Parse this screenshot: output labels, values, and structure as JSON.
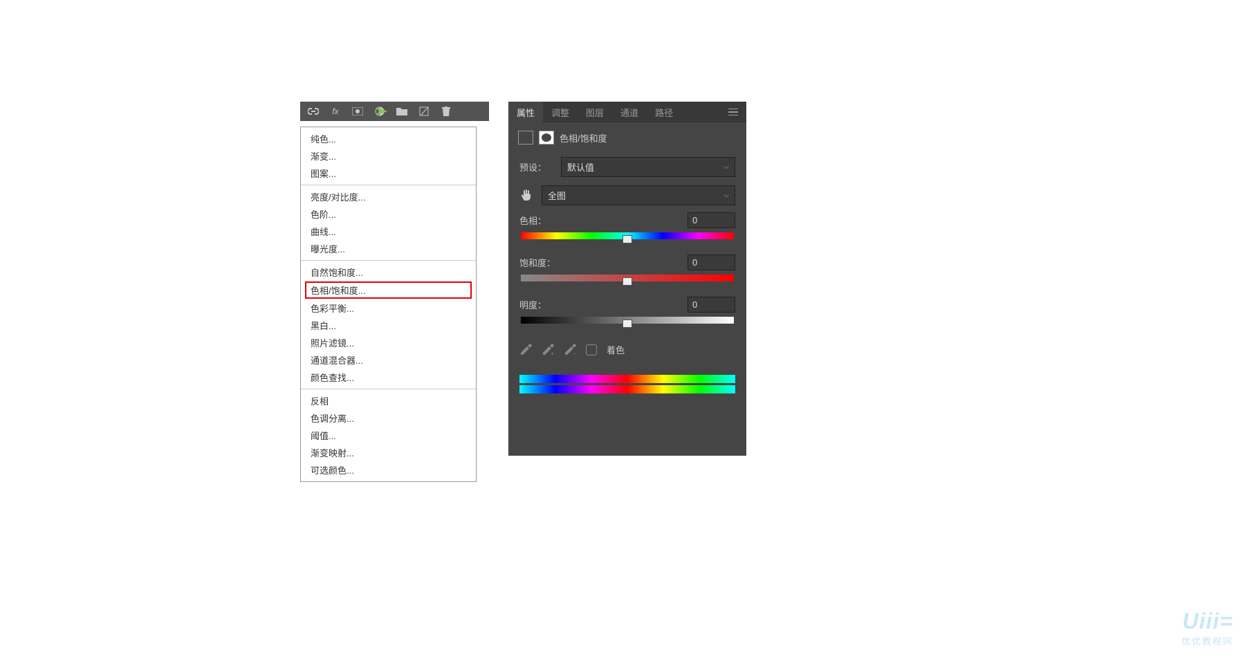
{
  "menu": {
    "g1": [
      "纯色...",
      "渐变...",
      "图案..."
    ],
    "g2": [
      "亮度/对比度...",
      "色阶...",
      "曲线...",
      "曝光度..."
    ],
    "g3": [
      "自然饱和度...",
      "色相/饱和度...",
      "色彩平衡...",
      "黑白...",
      "照片滤镜...",
      "通道混合器...",
      "颜色查找..."
    ],
    "g4": [
      "反相",
      "色调分离...",
      "阈值...",
      "渐变映射...",
      "可选颜色..."
    ]
  },
  "tabs": [
    "属性",
    "调整",
    "图层",
    "通道",
    "路径"
  ],
  "header": "色相/饱和度",
  "preset": {
    "label": "预设：",
    "value": "默认值"
  },
  "scope": "全图",
  "sliders": {
    "hue": {
      "label": "色相：",
      "value": "0"
    },
    "sat": {
      "label": "饱和度：",
      "value": "0"
    },
    "lig": {
      "label": "明度：",
      "value": "0"
    }
  },
  "colorize": "着色",
  "wm": {
    "big": "Uiii=",
    "sm": "优优教程网"
  }
}
